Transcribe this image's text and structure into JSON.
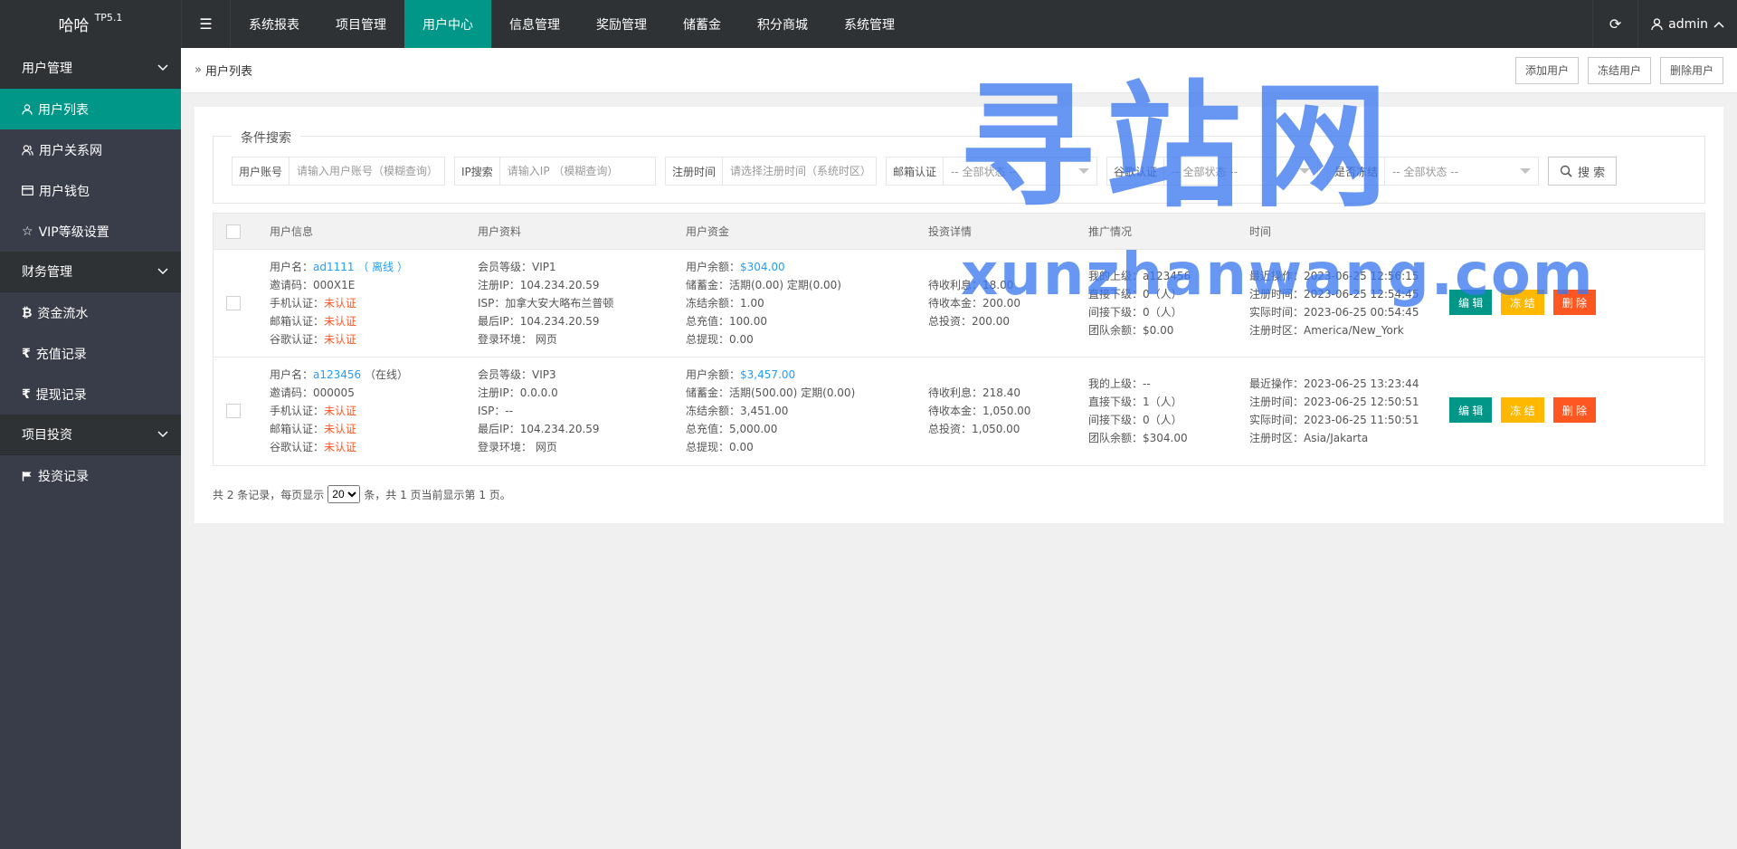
{
  "header": {
    "brand": "哈哈",
    "version": "TP5.1",
    "nav": [
      {
        "label": "系统报表",
        "active": false
      },
      {
        "label": "项目管理",
        "active": false
      },
      {
        "label": "用户中心",
        "active": true
      },
      {
        "label": "信息管理",
        "active": false
      },
      {
        "label": "奖励管理",
        "active": false
      },
      {
        "label": "储蓄金",
        "active": false
      },
      {
        "label": "积分商城",
        "active": false
      },
      {
        "label": "系统管理",
        "active": false
      }
    ],
    "user": "admin"
  },
  "sidebar": {
    "groups": [
      {
        "label": "用户管理",
        "items": [
          {
            "label": "用户列表",
            "icon": "user-icon",
            "active": true
          },
          {
            "label": "用户关系网",
            "icon": "users-icon"
          },
          {
            "label": "用户钱包",
            "icon": "wallet-icon"
          },
          {
            "label": "VIP等级设置",
            "icon": "star-icon"
          }
        ]
      },
      {
        "label": "财务管理",
        "items": [
          {
            "label": "资金流水",
            "icon": "bitcoin-icon"
          },
          {
            "label": "充值记录",
            "icon": "rupee-icon"
          },
          {
            "label": "提现记录",
            "icon": "rupee-icon"
          }
        ]
      },
      {
        "label": "项目投资",
        "items": [
          {
            "label": "投资记录",
            "icon": "flag-icon"
          }
        ]
      }
    ]
  },
  "breadcrumb": {
    "current": "用户列表"
  },
  "toolbar": {
    "add": "添加用户",
    "freeze": "冻结用户",
    "delete": "删除用户"
  },
  "search": {
    "legend": "条件搜索",
    "account": {
      "label": "用户账号",
      "placeholder": "请输入用户账号（模糊查询）"
    },
    "ip": {
      "label": "IP搜索",
      "placeholder": "请输入IP （模糊查询）"
    },
    "regtime": {
      "label": "注册时间",
      "placeholder": "请选择注册时间（系统时区）"
    },
    "email": {
      "label": "邮箱认证",
      "value": "-- 全部状态 --"
    },
    "google": {
      "label": "谷歌认证",
      "value": "-- 全部状态 --"
    },
    "frozen": {
      "label": "是否冻结",
      "value": "-- 全部状态 --"
    },
    "button": "搜 索"
  },
  "table": {
    "headers": [
      "用户信息",
      "用户资料",
      "用户资金",
      "投资详情",
      "推广情况",
      "时间"
    ],
    "rows": [
      {
        "info": {
          "name_label": "用户名：",
          "name": "ad1111",
          "status": "（ 离线 ）",
          "invite_label": "邀请码：",
          "invite": "000X1E",
          "phone_label": "手机认证：",
          "phone": "未认证",
          "email_label": "邮箱认证：",
          "email": "未认证",
          "google_label": "谷歌认证：",
          "google": "未认证"
        },
        "profile": {
          "level": "会员等级：VIP1",
          "regip": "注册IP：104.234.20.59",
          "isp": "ISP：加拿大安大略布兰普顿",
          "lastip": "最后IP：104.234.20.59",
          "env": "登录环境：  网页"
        },
        "funds": {
          "balance_label": "用户余额：",
          "balance": "$304.00",
          "savings": "储蓄金：活期(0.00) 定期(0.00)",
          "frozen": "冻结余额：1.00",
          "recharge": "总充值：100.00",
          "withdraw": "总提现：0.00"
        },
        "invest": {
          "interest": "待收利息：18.00",
          "principal": "待收本金：200.00",
          "total": "总投资：200.00"
        },
        "promo": {
          "parent": "我的上级：a123456",
          "direct": "直接下级：0（人）",
          "indirect": "间接下级：0（人）",
          "team": "团队余额：$0.00"
        },
        "time": {
          "last": "最近操作：2023-06-25 12:56:15",
          "reg": "注册时间：2023-06-25 12:54:45",
          "actual": "实际时间：2023-06-25 00:54:45",
          "tz": "注册时区：America/New_York"
        },
        "btns": {
          "edit": "编 辑",
          "freeze": "冻 结",
          "delete": "删 除"
        }
      },
      {
        "info": {
          "name_label": "用户名：",
          "name": "a123456",
          "status": "（在线）",
          "invite_label": "邀请码：",
          "invite": "000005",
          "phone_label": "手机认证：",
          "phone": "未认证",
          "email_label": "邮箱认证：",
          "email": "未认证",
          "google_label": "谷歌认证：",
          "google": "未认证"
        },
        "profile": {
          "level": "会员等级：VIP3",
          "regip": "注册IP：0.0.0.0",
          "isp": "ISP：--",
          "lastip": "最后IP：104.234.20.59",
          "env": "登录环境：  网页"
        },
        "funds": {
          "balance_label": "用户余额：",
          "balance": "$3,457.00",
          "savings": "储蓄金：活期(500.00) 定期(0.00)",
          "frozen": "冻结余额：3,451.00",
          "recharge": "总充值：5,000.00",
          "withdraw": "总提现：0.00"
        },
        "invest": {
          "interest": "待收利息：218.40",
          "principal": "待收本金：1,050.00",
          "total": "总投资：1,050.00"
        },
        "promo": {
          "parent": "我的上级：--",
          "direct": "直接下级：1（人）",
          "indirect": "间接下级：0（人）",
          "team": "团队余额：$304.00"
        },
        "time": {
          "last": "最近操作：2023-06-25 13:23:44",
          "reg": "注册时间：2023-06-25 12:50:51",
          "actual": "实际时间：2023-06-25 11:50:51",
          "tz": "注册时区：Asia/Jakarta"
        },
        "btns": {
          "edit": "编 辑",
          "freeze": "冻 结",
          "delete": "删 除"
        }
      }
    ]
  },
  "pager": {
    "prefix": "共 2 条记录，每页显示",
    "page_size": "20",
    "suffix": "条，共 1 页当前显示第 1 页。"
  },
  "watermark": {
    "big": "寻站网",
    "small": "xunzhanwang.com"
  },
  "colors": {
    "header": "#2f3235",
    "sidebar": "#393d49",
    "accent": "#009688",
    "link": "#1E9FFF",
    "warn": "#FF5722",
    "yellow": "#FFB800"
  }
}
